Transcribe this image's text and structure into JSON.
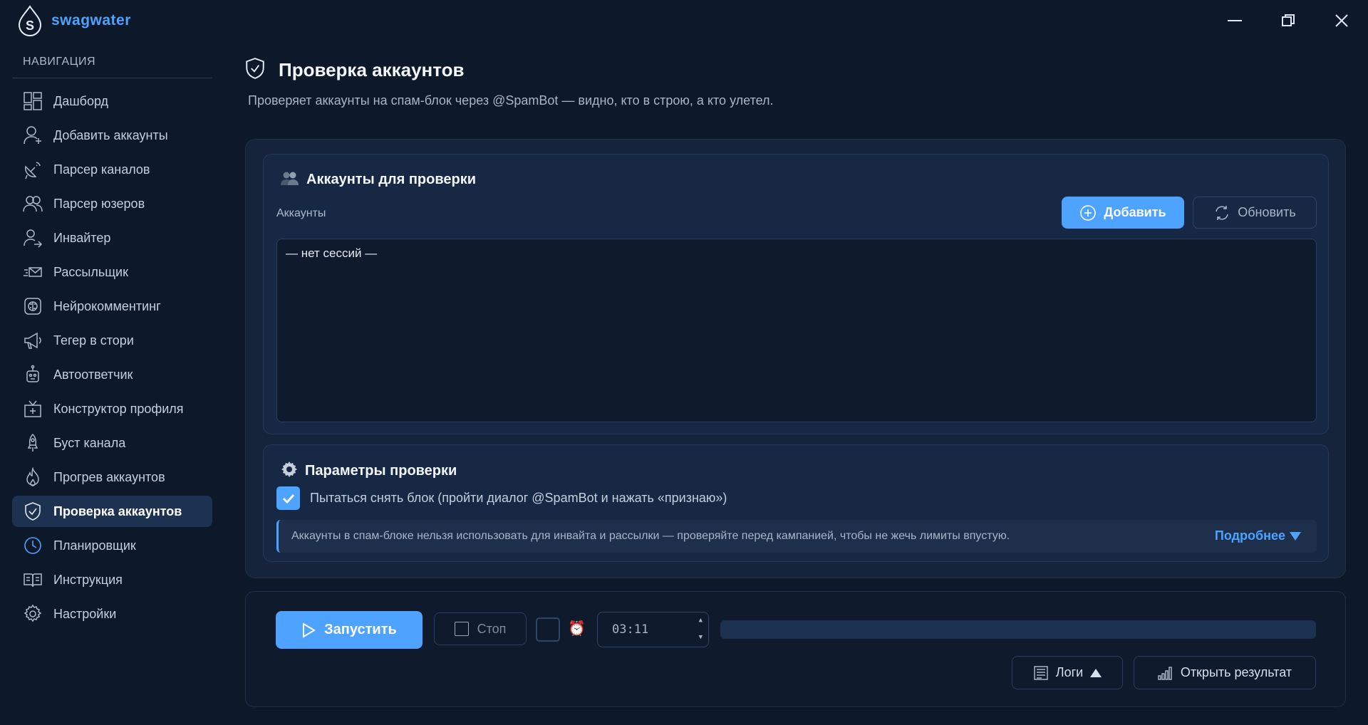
{
  "app": {
    "name": "swagwater",
    "accent": "#4da3ff"
  },
  "window_controls": [
    {
      "name": "minimize-icon"
    },
    {
      "name": "restore-icon"
    },
    {
      "name": "close-icon"
    }
  ],
  "sidebar": {
    "heading": "НАВИГАЦИЯ",
    "items": [
      {
        "label": "Дашборд",
        "icon": "dashboard-icon",
        "active": false
      },
      {
        "label": "Добавить аккаунты",
        "icon": "add-user-icon",
        "active": false
      },
      {
        "label": "Парсер каналов",
        "icon": "satellite-dish-icon",
        "active": false
      },
      {
        "label": "Парсер юзеров",
        "icon": "users-icon",
        "active": false
      },
      {
        "label": "Инвайтер",
        "icon": "user-arrow-icon",
        "active": false
      },
      {
        "label": "Рассыльщик",
        "icon": "mail-send-icon",
        "active": false
      },
      {
        "label": "Нейрокомментинг",
        "icon": "brain-icon",
        "active": false
      },
      {
        "label": "Тегер в стори",
        "icon": "megaphone-icon",
        "active": false
      },
      {
        "label": "Автоответчик",
        "icon": "robot-icon",
        "active": false
      },
      {
        "label": "Конструктор профиля",
        "icon": "tv-icon",
        "active": false
      },
      {
        "label": "Буст канала",
        "icon": "rocket-icon",
        "active": false
      },
      {
        "label": "Прогрев аккаунтов",
        "icon": "flame-icon",
        "active": false
      },
      {
        "label": "Проверка аккаунтов",
        "icon": "shield-check-icon",
        "active": true
      },
      {
        "label": "Планировщик",
        "icon": "clock-icon",
        "active": false
      },
      {
        "label": "Инструкция",
        "icon": "book-icon",
        "active": false
      },
      {
        "label": "Настройки",
        "icon": "gear-icon",
        "active": false
      }
    ]
  },
  "page": {
    "title": "Проверка аккаунтов",
    "subtitle": "Проверяет аккаунты на спам-блок через @SpamBot — видно, кто в строю, а кто улетел."
  },
  "accounts_card": {
    "title": "Аккаунты для проверки",
    "field_label": "Аккаунты",
    "add_label": "Добавить",
    "refresh_label": "Обновить",
    "empty_text": "— нет сессий —"
  },
  "params_card": {
    "title": "Параметры проверки",
    "unblock_checkbox_label": "Пытаться снять блок (пройти диалог @SpamBot и нажать «признаю»)",
    "unblock_checked": true,
    "info_text": "Аккаунты в спам-блоке нельзя использовать для инвайта и рассылки — проверяйте перед кампанией, чтобы не жечь лимиты впустую.",
    "more_label": "Подробнее"
  },
  "bottom": {
    "run_label": "Запустить",
    "stop_label": "Стоп",
    "time_value": "03:11",
    "progress": 0,
    "logs_label": "Логи",
    "result_label": "Открыть результат"
  }
}
